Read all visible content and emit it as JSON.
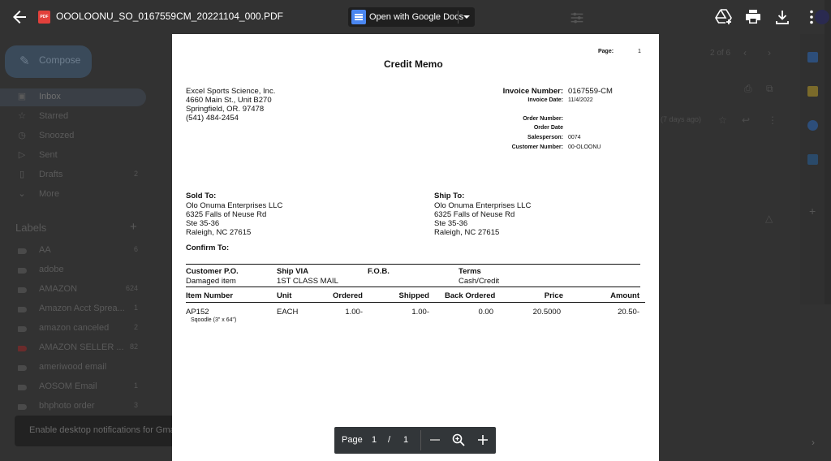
{
  "viewer": {
    "file_name": "OOOLOONU_SO_0167559CM_20221104_000.PDF",
    "file_badge": "PDF",
    "open_with_label": "Open with Google Docs"
  },
  "pdf": {
    "page_label": "Page:",
    "page_number": "1",
    "title": "Credit Memo",
    "company": [
      "Excel Sports Science, Inc.",
      "4660 Main St., Unit B270",
      "Springfield, OR. 97478",
      "(541) 484-2454"
    ],
    "invoice_number_label": "Invoice Number:",
    "invoice_number": "0167559-CM",
    "invoice_date_label": "Invoice Date:",
    "invoice_date": "11/4/2022",
    "order_number_label": "Order Number:",
    "order_date_label": "Order Date",
    "salesperson_label": "Salesperson:",
    "salesperson": "0074",
    "customer_number_label": "Customer Number:",
    "customer_number": "00-OLOONU",
    "sold_to_label": "Sold To:",
    "sold_to": [
      "Olo Onuma Enterprises LLC",
      "6325 Falls of Neuse Rd",
      "Ste 35-36",
      "Raleigh, NC  27615"
    ],
    "ship_to_label": "Ship To:",
    "ship_to": [
      "Olo Onuma Enterprises LLC",
      "6325 Falls of Neuse Rd",
      "Ste 35-36",
      "Raleigh, NC  27615"
    ],
    "confirm_to_label": "Confirm To:",
    "headers1": {
      "customer_po": "Customer P.O.",
      "ship_via": "Ship VIA",
      "fob": "F.O.B.",
      "terms": "Terms"
    },
    "values1": {
      "customer_po": "Damaged item",
      "ship_via": "1ST CLASS MAIL",
      "fob": "",
      "terms": "Cash/Credit"
    },
    "headers2": {
      "item": "Item Number",
      "unit": "Unit",
      "ordered": "Ordered",
      "shipped": "Shipped",
      "back_ordered": "Back Ordered",
      "price": "Price",
      "amount": "Amount"
    },
    "line_item": {
      "item": "AP152",
      "description": "Sqoodle (3\" x 64\")",
      "unit": "EACH",
      "ordered": "1.00-",
      "shipped": "1.00-",
      "back_ordered": "0.00",
      "price": "20.5000",
      "amount": "20.50-"
    }
  },
  "zoombar": {
    "page_label": "Page",
    "current": "1",
    "slash": "/",
    "total": "1"
  },
  "gmail_bg": {
    "compose": "Compose",
    "nav": [
      {
        "label": "Inbox",
        "count": ""
      },
      {
        "label": "Starred",
        "count": ""
      },
      {
        "label": "Snoozed",
        "count": ""
      },
      {
        "label": "Sent",
        "count": ""
      },
      {
        "label": "Drafts",
        "count": "2"
      },
      {
        "label": "More",
        "count": ""
      }
    ],
    "labels_header": "Labels",
    "labels": [
      {
        "label": "AA",
        "count": "6"
      },
      {
        "label": "adobe",
        "count": ""
      },
      {
        "label": "AMAZON",
        "count": "624"
      },
      {
        "label": "Amazon Acct Sprea...",
        "count": "1"
      },
      {
        "label": "amazon canceled",
        "count": "2"
      },
      {
        "label": "AMAZON SELLER ...",
        "count": "82"
      },
      {
        "label": "ameriwood email",
        "count": ""
      },
      {
        "label": "AOSOM Email",
        "count": "1"
      },
      {
        "label": "bhphoto order",
        "count": "3"
      }
    ],
    "pager": "2 of 6",
    "time_ago": "(7 days ago)",
    "toast": "Enable desktop notifications for Gmail"
  },
  "colors": {
    "pdf_badge": "#e2403b",
    "docs_blue": "#4a86f0",
    "backdrop": "#323232"
  }
}
